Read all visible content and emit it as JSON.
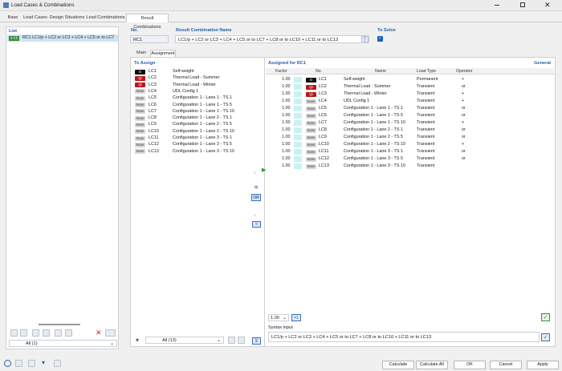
{
  "window": {
    "title": "Load Cases & Combinations"
  },
  "tabs": [
    "Base",
    "Load Cases",
    "Design Situations",
    "Load Combinations",
    "Result Combinations"
  ],
  "list": {
    "title": "List",
    "item_badge": "S Ch",
    "item_text": "RC1 LC1/p + LC2 or LC3 + LC4 + LC5 or to LC7",
    "filter": "All (1)"
  },
  "header": {
    "no_label": "No.",
    "no_value": "RC1",
    "name_label": "Result Combination Name",
    "name_value": "LC1/p + LC2 or LC3 + LC4 + LC5 or to LC7 + LC8 or to LC10 + LC11 or to LC13",
    "solve_label": "To Solve",
    "solve_checked": true
  },
  "subtabs": [
    "Main",
    "Assignment"
  ],
  "to_assign": {
    "title": "To Assign",
    "filter": "All (13)",
    "items": [
      {
        "badge": "G",
        "lc": "LC1",
        "name": "Self-weight"
      },
      {
        "badge": "Qt",
        "lc": "LC2",
        "name": "Thermal Load - Summer"
      },
      {
        "badge": "Qt",
        "lc": "LC3",
        "name": "Thermal Load - Winter"
      },
      {
        "badge": "None",
        "lc": "LC4",
        "name": "UDL Config 1"
      },
      {
        "badge": "None",
        "lc": "LC5",
        "name": "Configuration 1 - Lane 1 - TS 1"
      },
      {
        "badge": "None",
        "lc": "LC6",
        "name": "Configuration 1 - Lane 1 - TS 5"
      },
      {
        "badge": "None",
        "lc": "LC7",
        "name": "Configuration 1 - Lane 1 - TS 10"
      },
      {
        "badge": "None",
        "lc": "LC8",
        "name": "Configuration 1 - Lane 2 - TS 1"
      },
      {
        "badge": "None",
        "lc": "LC9",
        "name": "Configuration 1 - Lane 2 - TS 5"
      },
      {
        "badge": "None",
        "lc": "LC10",
        "name": "Configuration 1 - Lane 2 - TS 10"
      },
      {
        "badge": "None",
        "lc": "LC11",
        "name": "Configuration 1 - Lane 3 - TS 1"
      },
      {
        "badge": "None",
        "lc": "LC12",
        "name": "Configuration 1 - Lane 3 - TS 5"
      },
      {
        "badge": "None",
        "lc": "LC13",
        "name": "Configuration 1 - Lane 3 - TS 10"
      }
    ]
  },
  "middle_buttons": {
    "or_label": "OR"
  },
  "assigned": {
    "title": "Assigned for RC1",
    "general": "General",
    "columns": [
      "Factor",
      "No.",
      "Name",
      "Load Type",
      "Operator"
    ],
    "rows": [
      {
        "factor": "1.00",
        "badge": "G",
        "lc": "LC1",
        "name": "Self-weight",
        "type": "Permanent",
        "op": "+"
      },
      {
        "factor": "1.00",
        "badge": "Qt",
        "lc": "LC2",
        "name": "Thermal Load - Summer",
        "type": "Transient",
        "op": "or"
      },
      {
        "factor": "1.00",
        "badge": "Qt",
        "lc": "LC3",
        "name": "Thermal Load - Winter",
        "type": "Transient",
        "op": "+"
      },
      {
        "factor": "1.00",
        "badge": "None",
        "lc": "LC4",
        "name": "UDL Config 1",
        "type": "Transient",
        "op": "+"
      },
      {
        "factor": "1.00",
        "badge": "None",
        "lc": "LC5",
        "name": "Configuration 1 - Lane 1 - TS 1",
        "type": "Transient",
        "op": "or"
      },
      {
        "factor": "1.00",
        "badge": "None",
        "lc": "LC6",
        "name": "Configuration 1 - Lane 1 - TS 5",
        "type": "Transient",
        "op": "or"
      },
      {
        "factor": "1.00",
        "badge": "None",
        "lc": "LC7",
        "name": "Configuration 1 - Lane 1 - TS 10",
        "type": "Transient",
        "op": "+"
      },
      {
        "factor": "1.00",
        "badge": "None",
        "lc": "LC8",
        "name": "Configuration 1 - Lane 2 - TS 1",
        "type": "Transient",
        "op": "or"
      },
      {
        "factor": "1.00",
        "badge": "None",
        "lc": "LC9",
        "name": "Configuration 1 - Lane 2 - TS 5",
        "type": "Transient",
        "op": "or"
      },
      {
        "factor": "1.00",
        "badge": "None",
        "lc": "LC10",
        "name": "Configuration 1 - Lane 2 - TS 10",
        "type": "Transient",
        "op": "+"
      },
      {
        "factor": "1.00",
        "badge": "None",
        "lc": "LC11",
        "name": "Configuration 1 - Lane 3 - TS 1",
        "type": "Transient",
        "op": "or"
      },
      {
        "factor": "1.00",
        "badge": "None",
        "lc": "LC12",
        "name": "Configuration 1 - Lane 3 - TS 5",
        "type": "Transient",
        "op": "or"
      },
      {
        "factor": "1.00",
        "badge": "None",
        "lc": "LC13",
        "name": "Configuration 1 - Lane 3 - TS 10",
        "type": "Transient",
        "op": ""
      }
    ],
    "factor_select": "1.00",
    "factor_apply": "=1"
  },
  "syntax": {
    "label": "Syntax input",
    "value": "LC1/p + LC2 or LC3 + LC4 + LC5 or to LC7 + LC8 or to LC10 + LC11 or to LC13"
  },
  "footer": {
    "calculate": "Calculate",
    "calculate_all": "Calculate All",
    "ok": "OK",
    "cancel": "Cancel",
    "apply": "Apply"
  },
  "colors": {
    "accent": "#2a5ea8",
    "qt_badge": "#b8161c",
    "g_badge": "#111111",
    "highlight": "#c9f2f2",
    "green": "#2a9a2a"
  }
}
